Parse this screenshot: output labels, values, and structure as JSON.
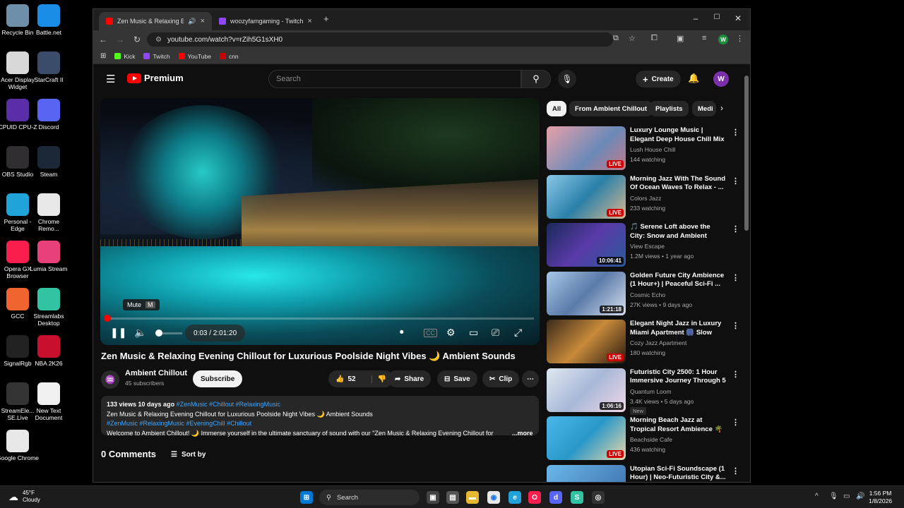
{
  "desktop": {
    "icons": [
      {
        "label": "Recycle Bin",
        "icon": "recycle-bin-icon",
        "color": "#6f8fa8"
      },
      {
        "label": "Battle.net",
        "icon": "battlenet-icon",
        "color": "#1a8ee6"
      },
      {
        "label": "Acer Display Widget",
        "icon": "acer-display-icon",
        "color": "#d8d8d8"
      },
      {
        "label": "StarCraft II",
        "icon": "starcraft-icon",
        "color": "#3b4b6a"
      },
      {
        "label": "CPUID CPU-Z",
        "icon": "cpuz-icon",
        "color": "#5a2ea8"
      },
      {
        "label": "Discord",
        "icon": "discord-icon",
        "color": "#5865f2"
      },
      {
        "label": "OBS Studio",
        "icon": "obs-icon",
        "color": "#302e31"
      },
      {
        "label": "Steam",
        "icon": "steam-icon",
        "color": "#1b2838"
      },
      {
        "label": "Personal - Edge",
        "icon": "edge-icon",
        "color": "#1fa3d8"
      },
      {
        "label": "Chrome Remo...",
        "icon": "chrome-remote-icon",
        "color": "#e8e8e8"
      },
      {
        "label": "Opera GX Browser",
        "icon": "opera-gx-icon",
        "color": "#fa1e4e"
      },
      {
        "label": "Lumia Stream",
        "icon": "lumia-icon",
        "color": "#e8407a"
      },
      {
        "label": "GCC",
        "icon": "gcc-icon",
        "color": "#f0652f"
      },
      {
        "label": "Streamlabs Desktop",
        "icon": "streamlabs-icon",
        "color": "#31c3a2"
      },
      {
        "label": "SignalRgb",
        "icon": "signalrgb-icon",
        "color": "#222222"
      },
      {
        "label": "NBA 2K26",
        "icon": "nba2k-icon",
        "color": "#c8102e"
      },
      {
        "label": "StreamEle... SE.Live",
        "icon": "streamelements-icon",
        "color": "#333333"
      },
      {
        "label": "New Text Document",
        "icon": "text-document-icon",
        "color": "#f0f0f0"
      },
      {
        "label": "Google Chrome",
        "icon": "chrome-icon",
        "color": "#e8e8e8"
      }
    ]
  },
  "browser": {
    "tabs": [
      {
        "title": "Zen Music & Relaxing Even",
        "color": "#ff0000"
      },
      {
        "title": "woozyfamgaming - Twitch",
        "color": "#9146ff"
      }
    ],
    "new_tab": "+",
    "url": "youtube.com/watch?v=rZih5G1sXH0",
    "bookmarks": [
      {
        "label": "Kick",
        "color": "#53fc18"
      },
      {
        "label": "Twitch",
        "color": "#9146ff"
      },
      {
        "label": "YouTube",
        "color": "#ff0000"
      },
      {
        "label": "cnn",
        "color": "#cc0000"
      }
    ],
    "profile_initial": "W"
  },
  "youtube": {
    "logo": "Premium",
    "search_placeholder": "Search",
    "create_label": "Create",
    "avatar_initial": "W",
    "player": {
      "mute_tip": "Mute",
      "mute_key": "M",
      "time": "0:03 / 2:01:20",
      "progress_fraction": 0.0004,
      "volume_fraction": 0.0
    },
    "video": {
      "title": "Zen Music & Relaxing Evening Chillout for Luxurious Poolside Night Vibes 🌙 Ambient Sounds",
      "channel": "Ambient Chillout",
      "subscribers": "45 subscribers",
      "subscribe_label": "Subscribe",
      "likes": "52",
      "share_label": "Share",
      "save_label": "Save",
      "clip_label": "Clip",
      "desc_meta": "133 views  10 days ago",
      "desc_tags_inline": "#ZenMusic #Chillout #RelaxingMusic",
      "desc_line2": "Zen Music & Relaxing Evening Chillout for Luxurious Poolside Night Vibes 🌙 Ambient Sounds",
      "desc_line3": "#ZenMusic #RelaxingMusic #EveningChill #Chillout",
      "desc_line4": "Welcome to Ambient Chillout! 🌙 Immerse yourself in the ultimate sanctuary of sound with our \"Zen Music & Relaxing Evening Chillout for",
      "more_label": "...more",
      "comments": "0 Comments",
      "sort_label": "Sort by"
    },
    "chips": [
      "All",
      "From Ambient Chillout",
      "Playlists",
      "Medi"
    ],
    "recommendations": [
      {
        "title": "Luxury Lounge Music | Elegant Deep House Chill Mix for Suns...",
        "channel": "Lush House Chill",
        "meta": "144 watching",
        "badge": "LIVE",
        "live": true,
        "bg": "linear-gradient(135deg,#e8a0a8,#6a8ab8 60%,#c27a8a)"
      },
      {
        "title": "Morning Jazz With The Sound Of Ocean Waves To Relax - ...",
        "channel": "Colors Jazz",
        "meta": "233 watching",
        "badge": "LIVE",
        "live": true,
        "bg": "linear-gradient(135deg,#8ac8e8,#2a80a8 50%,#d8b890)"
      },
      {
        "title": "🎵 Serene Loft above the City: Snow and Ambient Music | ...",
        "channel": "View Escape",
        "meta": "1.2M views • 1 year ago",
        "badge": "10:06:41",
        "live": false,
        "bg": "linear-gradient(135deg,#1a2a5a,#5a3aa8 50%,#2a5a9a)"
      },
      {
        "title": "Golden Future City Ambience (1 Hour+) | Peaceful Sci-Fi ...",
        "channel": "Cosmic Echo",
        "meta": "27K views • 9 days ago",
        "badge": "1:21:18",
        "live": false,
        "bg": "linear-gradient(135deg,#a8c8e8,#5a7aa8 50%,#d8e0f0)"
      },
      {
        "title": "Elegant Night Jazz in Luxury Miami Apartment 🎆 Slow Jaz...",
        "channel": "Cozy Jazz Apartment",
        "meta": "180 watching",
        "badge": "LIVE",
        "live": true,
        "bg": "linear-gradient(135deg,#3a2a1a,#c88a3a 50%,#2a1a10)"
      },
      {
        "title": "Futuristic City 2500: 1 Hour Immersive Journey Through 5 ...",
        "channel": "Quantum Loom",
        "meta": "3.4K views • 5 days ago",
        "badge": "1:06:16",
        "live": false,
        "new": "New",
        "bg": "linear-gradient(135deg,#e0e8f0,#a8b8d8 50%,#f0d8e8)"
      },
      {
        "title": "Morning Beach Jazz at Tropical Resort Ambience 🌴 Smooth ...",
        "channel": "Beachside Cafe",
        "meta": "436 watching",
        "badge": "LIVE",
        "live": true,
        "bg": "linear-gradient(135deg,#4ab8e8,#2a98c8 50%,#e8d8a8)"
      },
      {
        "title": "Utopian Sci-Fi Soundscape (1 Hour) | Neo-Futuristic City &...",
        "channel": "",
        "meta": "",
        "badge": "",
        "live": false,
        "bg": "linear-gradient(135deg,#6ab8e8,#3a6aa8)"
      }
    ]
  },
  "taskbar": {
    "weather_temp": "45°F",
    "weather_cond": "Cloudy",
    "search_label": "Search",
    "time": "1:56 PM",
    "date": "1/8/2026"
  }
}
